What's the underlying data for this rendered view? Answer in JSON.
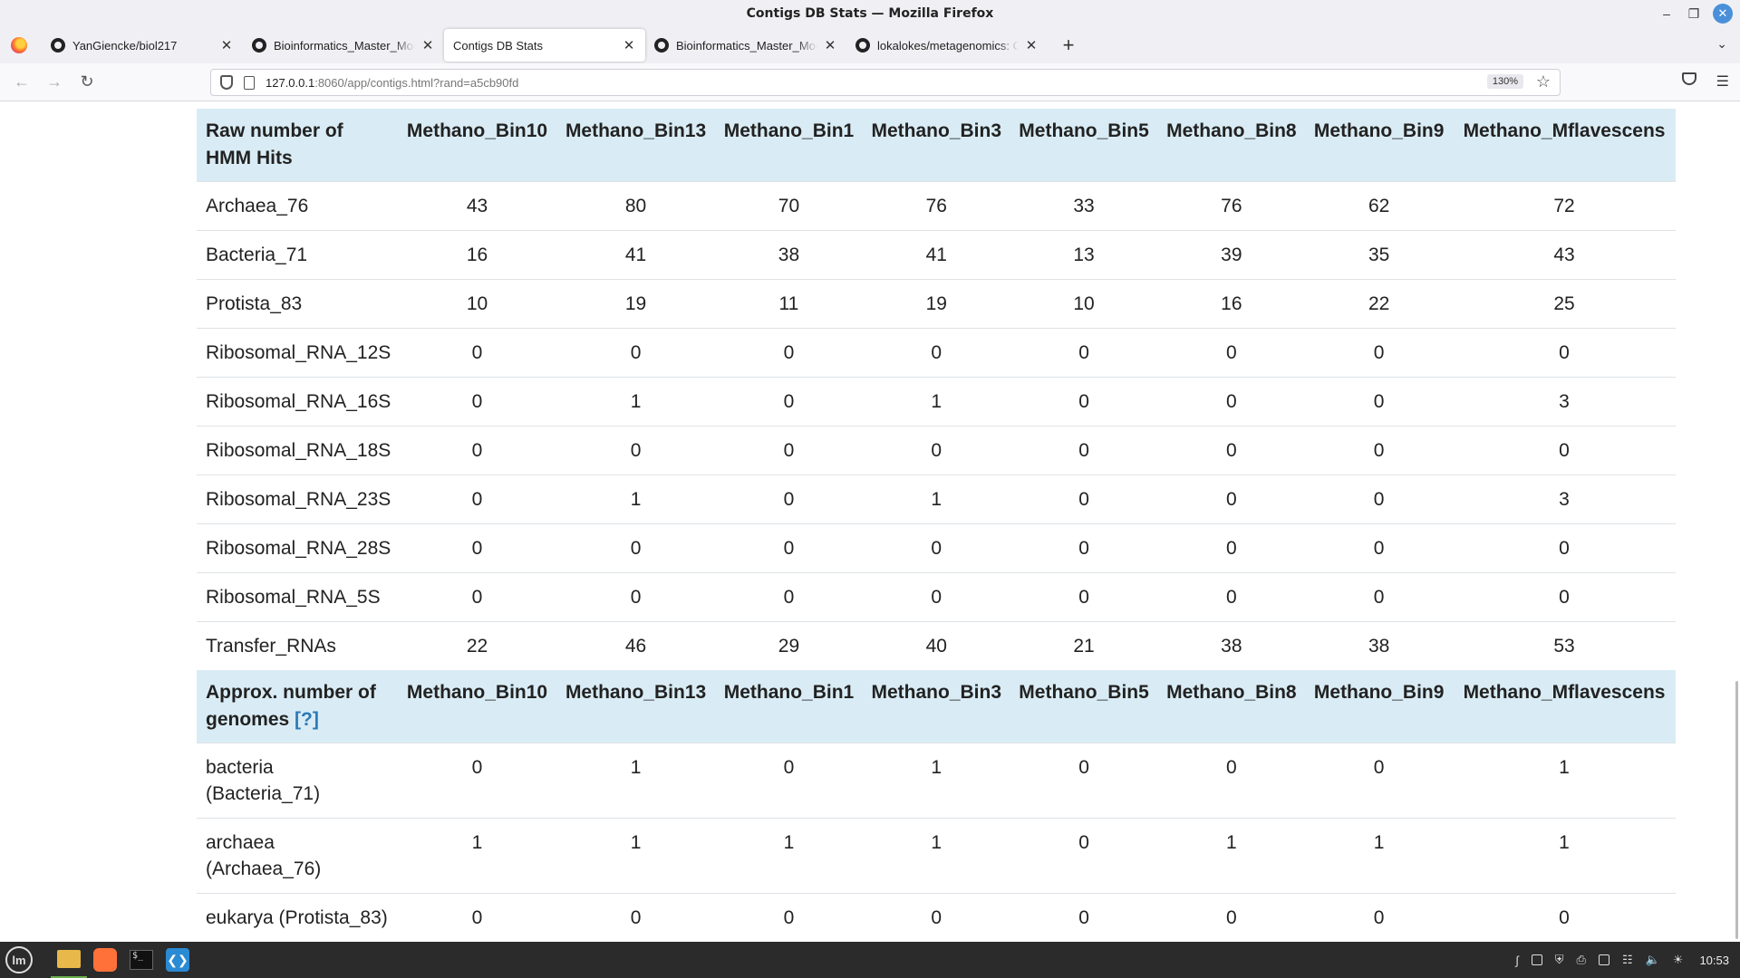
{
  "window": {
    "title": "Contigs DB Stats — Mozilla Firefox"
  },
  "tabs": [
    {
      "label": "YanGiencke/biol217",
      "active": false
    },
    {
      "label": "Bioinformatics_Master_Mod",
      "active": false
    },
    {
      "label": "Contigs DB Stats",
      "active": true
    },
    {
      "label": "Bioinformatics_Master_Mod",
      "active": false
    },
    {
      "label": "lokalokes/metagenomics: C",
      "active": false
    }
  ],
  "urlbar": {
    "host": "127.0.0.1",
    "path": ":8060/app/contigs.html?rand=a5cb90fd",
    "zoom": "130%"
  },
  "hmm_table": {
    "header": "Raw number of HMM Hits",
    "columns": [
      "Methano_Bin10",
      "Methano_Bin13",
      "Methano_Bin1",
      "Methano_Bin3",
      "Methano_Bin5",
      "Methano_Bin8",
      "Methano_Bin9",
      "Methano_Mflavescens"
    ],
    "rows": [
      {
        "name": "Archaea_76",
        "values": [
          "43",
          "80",
          "70",
          "76",
          "33",
          "76",
          "62",
          "72"
        ]
      },
      {
        "name": "Bacteria_71",
        "values": [
          "16",
          "41",
          "38",
          "41",
          "13",
          "39",
          "35",
          "43"
        ]
      },
      {
        "name": "Protista_83",
        "values": [
          "10",
          "19",
          "11",
          "19",
          "10",
          "16",
          "22",
          "25"
        ]
      },
      {
        "name": "Ribosomal_RNA_12S",
        "values": [
          "0",
          "0",
          "0",
          "0",
          "0",
          "0",
          "0",
          "0"
        ]
      },
      {
        "name": "Ribosomal_RNA_16S",
        "values": [
          "0",
          "1",
          "0",
          "1",
          "0",
          "0",
          "0",
          "3"
        ]
      },
      {
        "name": "Ribosomal_RNA_18S",
        "values": [
          "0",
          "0",
          "0",
          "0",
          "0",
          "0",
          "0",
          "0"
        ]
      },
      {
        "name": "Ribosomal_RNA_23S",
        "values": [
          "0",
          "1",
          "0",
          "1",
          "0",
          "0",
          "0",
          "3"
        ]
      },
      {
        "name": "Ribosomal_RNA_28S",
        "values": [
          "0",
          "0",
          "0",
          "0",
          "0",
          "0",
          "0",
          "0"
        ]
      },
      {
        "name": "Ribosomal_RNA_5S",
        "values": [
          "0",
          "0",
          "0",
          "0",
          "0",
          "0",
          "0",
          "0"
        ]
      },
      {
        "name": "Transfer_RNAs",
        "values": [
          "22",
          "46",
          "29",
          "40",
          "21",
          "38",
          "38",
          "53"
        ]
      }
    ]
  },
  "genome_table": {
    "header": "Approx. number of genomes",
    "help_link": "[?]",
    "columns": [
      "Methano_Bin10",
      "Methano_Bin13",
      "Methano_Bin1",
      "Methano_Bin3",
      "Methano_Bin5",
      "Methano_Bin8",
      "Methano_Bin9",
      "Methano_Mflavescens"
    ],
    "rows": [
      {
        "name": "bacteria (Bacteria_71)",
        "values": [
          "0",
          "1",
          "0",
          "1",
          "0",
          "0",
          "0",
          "1"
        ]
      },
      {
        "name": "archaea (Archaea_76)",
        "values": [
          "1",
          "1",
          "1",
          "1",
          "0",
          "1",
          "1",
          "1"
        ]
      },
      {
        "name": "eukarya (Protista_83)",
        "values": [
          "0",
          "0",
          "0",
          "0",
          "0",
          "0",
          "0",
          "0"
        ]
      }
    ]
  },
  "taskbar": {
    "clock": "10:53"
  }
}
